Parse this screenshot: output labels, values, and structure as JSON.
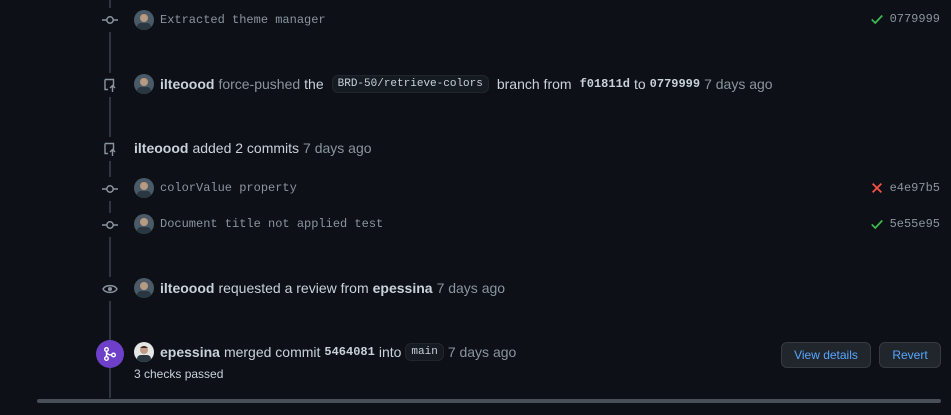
{
  "timeline": {
    "commit_top": {
      "message": "Extracted theme manager",
      "status": "success",
      "sha": "0779999"
    },
    "force_push": {
      "author": "ilteoood",
      "action": "force-pushed",
      "the_word": "the",
      "branch": "BRD-50/retrieve-colors",
      "branch_word": "branch from",
      "from_sha": "f01811d",
      "to_word": "to",
      "to_sha": "0779999",
      "time": "7 days ago"
    },
    "added_commits": {
      "author": "ilteoood",
      "action": "added 2 commits",
      "time": "7 days ago"
    },
    "commits": [
      {
        "message": "colorValue property",
        "status": "failure",
        "sha": "e4e97b5"
      },
      {
        "message": "Document title not applied test",
        "status": "success",
        "sha": "5e55e95"
      }
    ],
    "review_request": {
      "author": "ilteoood",
      "action": "requested a review from",
      "reviewer": "epessina",
      "time": "7 days ago"
    },
    "merge": {
      "author": "epessina",
      "action": "merged commit",
      "sha": "5464081",
      "into_word": "into",
      "branch": "main",
      "time": "7 days ago",
      "checks": "3 checks passed",
      "view_details_label": "View details",
      "revert_label": "Revert"
    }
  },
  "colors": {
    "success": "#3fb950",
    "failure": "#f85149",
    "merge_badge": "#6e40c9",
    "link": "#58a6ff"
  },
  "icons": {
    "commit": "git-commit-icon",
    "push": "repo-push-icon",
    "eye": "eye-icon",
    "merge": "git-merge-icon",
    "check": "check-icon",
    "x": "x-icon"
  }
}
